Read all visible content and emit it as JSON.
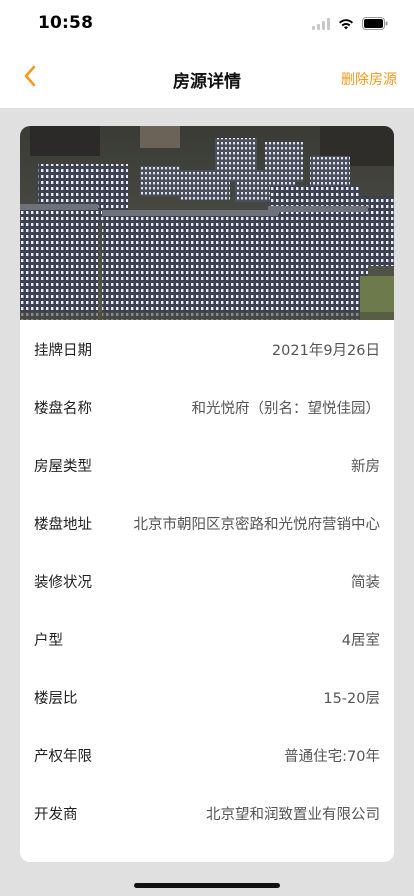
{
  "status": {
    "time": "10:58"
  },
  "nav": {
    "title": "房源详情",
    "action": "删除房源"
  },
  "details": [
    {
      "label": "挂牌日期",
      "value": "2021年9月26日"
    },
    {
      "label": "楼盘名称",
      "value": "和光悦府（别名：望悦佳园）"
    },
    {
      "label": "房屋类型",
      "value": "新房"
    },
    {
      "label": "楼盘地址",
      "value": "北京市朝阳区京密路和光悦府营销中心"
    },
    {
      "label": "装修状况",
      "value": "简装"
    },
    {
      "label": "户型",
      "value": "4居室"
    },
    {
      "label": "楼层比",
      "value": "15-20层"
    },
    {
      "label": "产权年限",
      "value": "普通住宅:70年"
    },
    {
      "label": "开发商",
      "value": "北京望和润致置业有限公司"
    }
  ],
  "colors": {
    "accent": "#f39a1e",
    "page_background": "#e0e0e0",
    "card_background": "#ffffff"
  },
  "icons": {
    "back": "chevron-left-icon",
    "signal": "signal-bars-icon",
    "wifi": "wifi-icon",
    "battery": "battery-icon"
  }
}
